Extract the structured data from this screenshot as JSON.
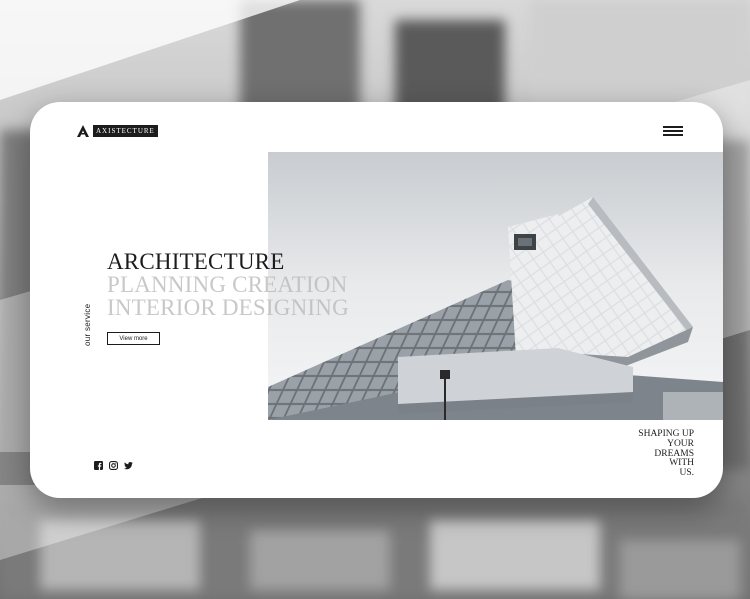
{
  "brand": {
    "name": "AXISTECTURE"
  },
  "hero": {
    "side_label": "our service",
    "headline": "ARCHITECTURE",
    "sublines": [
      "PLANNING CREATION",
      "INTERIOR DESIGNING"
    ],
    "cta_label": "View more"
  },
  "tagline": [
    "SHAPING UP",
    "YOUR",
    "DREAMS",
    "WITH",
    "US."
  ],
  "social": [
    "facebook-icon",
    "instagram-icon",
    "twitter-icon"
  ],
  "menu": {
    "icon": "hamburger-menu-icon"
  },
  "colors": {
    "text": "#1c1c1c",
    "faded_text": "#b9b9b9",
    "card": "#ffffff"
  }
}
